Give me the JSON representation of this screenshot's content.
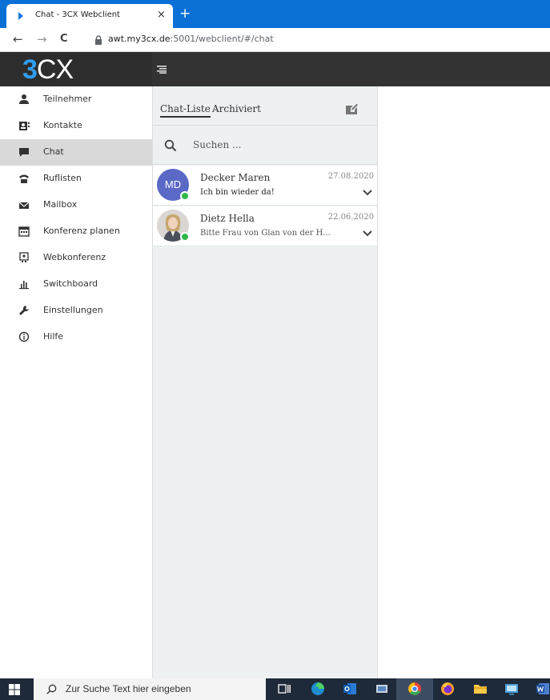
{
  "browser": {
    "tab_title": "Chat - 3CX Webclient",
    "close_glyph": "×",
    "newtab_glyph": "+",
    "back_glyph": "←",
    "forward_glyph": "→",
    "reload_glyph": "C",
    "url_host": "awt.my3cx.de",
    "url_path": ":5001/webclient/#/chat"
  },
  "app": {
    "logo_three": "3",
    "logo_cx": "CX",
    "brand_color": "#2e9df0"
  },
  "sidebar": {
    "items": [
      {
        "label": "Teilnehmer",
        "icon": "person-icon"
      },
      {
        "label": "Kontakte",
        "icon": "contacts-card-icon"
      },
      {
        "label": "Chat",
        "icon": "chat-bubble-icon",
        "active": true
      },
      {
        "label": "Ruflisten",
        "icon": "phone-icon"
      },
      {
        "label": "Mailbox",
        "icon": "envelope-icon"
      },
      {
        "label": "Konferenz planen",
        "icon": "calendar-icon"
      },
      {
        "label": "Webkonferenz",
        "icon": "webmeeting-icon"
      },
      {
        "label": "Switchboard",
        "icon": "bar-chart-icon"
      },
      {
        "label": "Einstellungen",
        "icon": "wrench-icon"
      },
      {
        "label": "Hilfe",
        "icon": "info-icon"
      }
    ]
  },
  "chat": {
    "tab_list": "Chat-Liste",
    "tab_archived": "Archiviert",
    "search_placeholder": "Suchen ...",
    "items": [
      {
        "initials": "MD",
        "name": "Decker Maren",
        "date": "27.08.2020",
        "preview": "Ich bin wieder da!",
        "status": "online"
      },
      {
        "initials": "",
        "name": "Dietz Hella",
        "date": "22.06.2020",
        "preview": "Bitte Frau von Glan von der H...",
        "status": "online"
      }
    ]
  },
  "taskbar": {
    "search_text": "Zur Suche Text hier eingeben"
  }
}
